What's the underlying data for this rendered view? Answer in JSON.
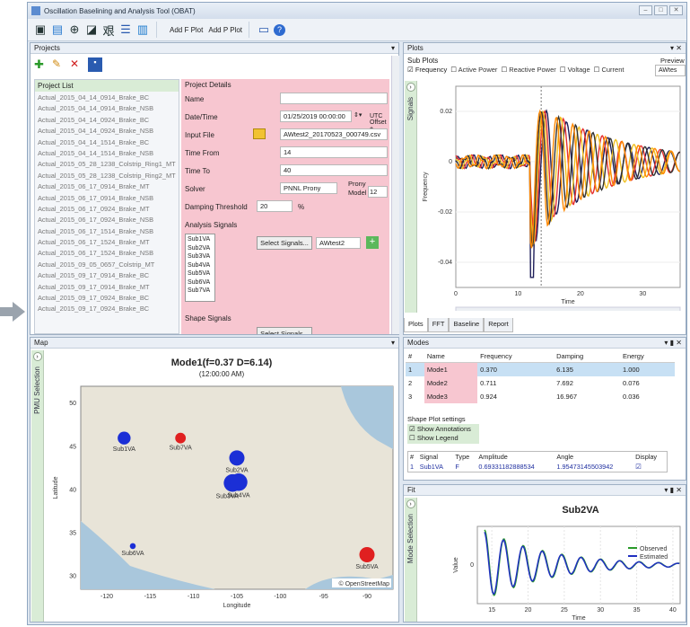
{
  "window": {
    "title": "Oscillation Baselining and Analysis Tool (OBAT)"
  },
  "toolbar": {
    "add_f_plot": "Add F Plot",
    "add_p_plot": "Add P Plot"
  },
  "projects": {
    "panel_title": "Projects",
    "list_header": "Project List",
    "items": [
      "Actual_2015_04_14_0914_Brake_BC",
      "Actual_2015_04_14_0914_Brake_NSB",
      "Actual_2015_04_14_0924_Brake_BC",
      "Actual_2015_04_14_0924_Brake_NSB",
      "Actual_2015_04_14_1514_Brake_BC",
      "Actual_2015_04_14_1514_Brake_NSB",
      "Actual_2015_05_28_1238_Colstrip_Ring1_MT",
      "Actual_2015_05_28_1238_Colstrip_Ring2_MT",
      "Actual_2015_06_17_0914_Brake_MT",
      "Actual_2015_06_17_0914_Brake_NSB",
      "Actual_2015_06_17_0924_Brake_MT",
      "Actual_2015_06_17_0924_Brake_NSB",
      "Actual_2015_06_17_1514_Brake_NSB",
      "Actual_2015_06_17_1524_Brake_MT",
      "Actual_2015_06_17_1524_Brake_NSB",
      "Actual_2015_09_05_0657_Colstrip_MT",
      "Actual_2015_09_17_0914_Brake_BC",
      "Actual_2015_09_17_0914_Brake_MT",
      "Actual_2015_09_17_0924_Brake_BC",
      "Actual_2015_09_17_0924_Brake_BC"
    ],
    "details": {
      "header": "Project Details",
      "name_label": "Name",
      "name_value": "",
      "datetime_label": "Date/Time",
      "datetime_value": "01/25/2019 00:00:00",
      "utc_label": "UTC Offset +",
      "input_label": "Input File",
      "input_value": "AWtest2_20170523_000749.csv",
      "time_from_label": "Time From",
      "time_from_value": "14",
      "time_to_label": "Time To",
      "time_to_value": "40",
      "solver_label": "Solver",
      "solver_value": "PNNL Prony",
      "prony_label": "Prony",
      "model_order_label": "Model Order",
      "model_order_value": "12",
      "damping_label": "Damping Threshold",
      "damping_value": "20",
      "damping_unit": "%",
      "analysis_label": "Analysis Signals",
      "signals": [
        "Sub1VA",
        "Sub2VA",
        "Sub3VA",
        "Sub4VA",
        "Sub5VA",
        "Sub6VA",
        "Sub7VA"
      ],
      "select_signals": "Select Signals...",
      "dataset_value": "AWtest2",
      "shape_label": "Shape Signals",
      "select_signals2": "Select Signals..."
    }
  },
  "plots": {
    "panel_title": "Plots",
    "sub_plots_label": "Sub Plots",
    "preview_label": "Preview",
    "preview_value": "AWtes",
    "checks": [
      {
        "label": "Frequency",
        "checked": true
      },
      {
        "label": "Active Power",
        "checked": false
      },
      {
        "label": "Reactive Power",
        "checked": false
      },
      {
        "label": "Voltage",
        "checked": false
      },
      {
        "label": "Current",
        "checked": false
      }
    ],
    "side_tab": "Signals",
    "ylabel": "Frequency",
    "xlabel": "Time",
    "yticks": [
      "0.02",
      "0",
      "-0.02",
      "-0.04"
    ],
    "xticks": [
      "0",
      "10",
      "20",
      "30"
    ],
    "tabs": [
      "Plots",
      "FFT",
      "Baseline",
      "Report"
    ]
  },
  "map": {
    "panel_title": "Map",
    "side_tab": "PMU Selection",
    "title": "Mode1(f=0.37 D=6.14)",
    "subtitle": "(12:00:00 AM)",
    "ylabel": "Latitude",
    "xlabel": "Longitude",
    "yticks": [
      "50",
      "45",
      "40",
      "35",
      "30"
    ],
    "xticks": [
      "-120",
      "-115",
      "-110",
      "-105",
      "-100",
      "-95",
      "-90"
    ],
    "attribution": "© OpenStreetMap",
    "points": [
      {
        "label": "Sub1VA",
        "lon": -118,
        "lat": 46,
        "size": 4,
        "color": "#1b2fd6"
      },
      {
        "label": "Sub7VA",
        "lon": -111.5,
        "lat": 46,
        "size": 3,
        "color": "#e02020"
      },
      {
        "label": "Sub2VA",
        "lon": -105,
        "lat": 43.7,
        "size": 5,
        "color": "#1b2fd6"
      },
      {
        "label": "Sub3VA",
        "lon": -105.5,
        "lat": 40.8,
        "size": 6,
        "color": "#1b2fd6"
      },
      {
        "label": "Sub4VA",
        "lon": -104.8,
        "lat": 40.9,
        "size": 6,
        "color": "#1b2fd6"
      },
      {
        "label": "Sub6VA",
        "lon": -117,
        "lat": 33.5,
        "size": 1,
        "color": "#1b2fd6"
      },
      {
        "label": "Sub5VA",
        "lon": -90,
        "lat": 32.5,
        "size": 5,
        "color": "#e02020"
      }
    ]
  },
  "modes": {
    "panel_title": "Modes",
    "headers": [
      "#",
      "Name",
      "Frequency",
      "Damping",
      "Energy"
    ],
    "rows": [
      [
        "1",
        "Mode1",
        "0.370",
        "6.135",
        "1.000"
      ],
      [
        "2",
        "Mode2",
        "0.711",
        "7.692",
        "0.076"
      ],
      [
        "3",
        "Mode3",
        "0.924",
        "16.967",
        "0.036"
      ]
    ],
    "shape_settings": "Shape Plot settings",
    "show_annotations": "Show Annotations",
    "show_legend": "Show Legend",
    "sig_headers": [
      "#",
      "Signal",
      "Type",
      "Amplitude",
      "Angle",
      "Display"
    ],
    "sig_row": [
      "1",
      "Sub1VA",
      "F",
      "0.69331182888534",
      "1.95473145503942",
      ""
    ]
  },
  "fit": {
    "panel_title": "Fit",
    "side_tab": "Mode Selection",
    "title": "Sub2VA",
    "ylabel": "Value",
    "xlabel": "Time",
    "yticks": [
      "0"
    ],
    "xticks": [
      "15",
      "20",
      "25",
      "30",
      "35",
      "40"
    ],
    "legend": [
      "Observed",
      "Estimated"
    ]
  },
  "colors": {
    "pink": "#f7c6d0",
    "green_tab": "#d9ecd6",
    "select_blue": "#c7e0f4"
  },
  "chart_data": [
    {
      "type": "line",
      "title": "",
      "xlabel": "Time",
      "ylabel": "Frequency",
      "xlim": [
        0,
        36
      ],
      "ylim": [
        -0.05,
        0.03
      ],
      "note_series_colors": [
        "#1f1f5a",
        "#e53030",
        "#f0c020",
        "#333333",
        "#ff8800"
      ]
    },
    {
      "type": "line",
      "title": "Sub2VA",
      "xlabel": "Time",
      "ylabel": "Value",
      "xlim": [
        13,
        41
      ],
      "series": [
        {
          "name": "Observed",
          "color": "#2a9a2a"
        },
        {
          "name": "Estimated",
          "color": "#2030c0"
        }
      ]
    }
  ]
}
